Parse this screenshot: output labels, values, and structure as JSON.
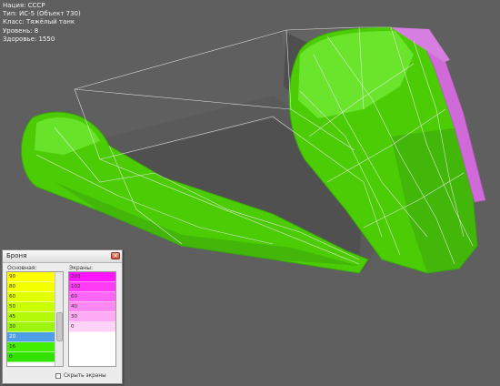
{
  "tank_info": {
    "nation": "Нация: СССР",
    "type": "Тип: ИС-5 (Объект 730)",
    "class": "Класс: Тяжёлый танк",
    "level": "Уровень: 8",
    "health": "Здоровье: 1550"
  },
  "colors": {
    "background": "#5f5f5f",
    "armor_main": "#4ccc05",
    "armor_highlight": "#74ee3a",
    "armor_shadow": "#3aa50d",
    "screen_armor": "#d06ad8",
    "inner_surface": "#575757",
    "wire": "#e8e8e8"
  },
  "armor_window": {
    "title": "Броня",
    "close_icon": "×",
    "base_label": "Основная:",
    "screens_label": "Экраны:",
    "base_rows": [
      {
        "value": "90",
        "color": "#ffff00"
      },
      {
        "value": "80",
        "color": "#f4ff00"
      },
      {
        "value": "60",
        "color": "#e2ff00"
      },
      {
        "value": "50",
        "color": "#caff00"
      },
      {
        "value": "45",
        "color": "#b4f90a"
      },
      {
        "value": "30",
        "color": "#9ef40e"
      },
      {
        "value": "20",
        "color": "#4f9fe8",
        "selected": true
      },
      {
        "value": "16",
        "color": "#44ee00"
      },
      {
        "value": "0",
        "color": "#33e200"
      }
    ],
    "screen_rows": [
      {
        "value": "203",
        "color": "#ff16ff"
      },
      {
        "value": "102",
        "color": "#ff3bf5"
      },
      {
        "value": "60",
        "color": "#ff66f5"
      },
      {
        "value": "40",
        "color": "#ff88f2"
      },
      {
        "value": "30",
        "color": "#ffaaf4"
      },
      {
        "value": "0",
        "color": "#ffd2f8"
      }
    ],
    "hide_screens_label": "Скрыть экраны",
    "hide_screens_checked": false
  }
}
